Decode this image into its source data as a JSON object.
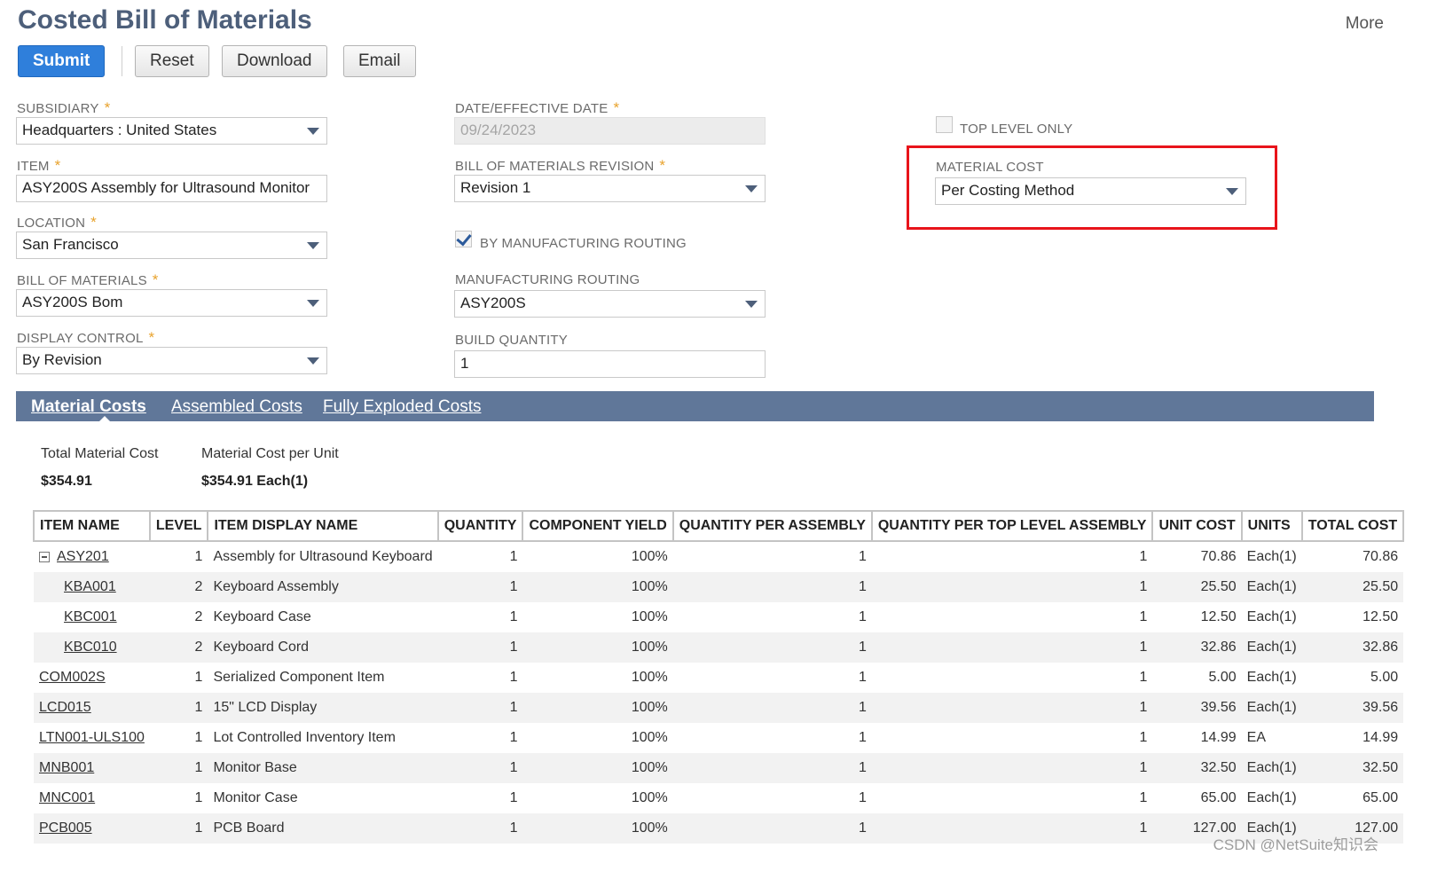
{
  "page": {
    "title": "Costed Bill of Materials",
    "more": "More"
  },
  "buttons": {
    "submit": "Submit",
    "reset": "Reset",
    "download": "Download",
    "email": "Email"
  },
  "fields": {
    "subsidiary": {
      "label": "SUBSIDIARY",
      "value": "Headquarters : United States",
      "required": "*"
    },
    "item": {
      "label": "ITEM",
      "value": "ASY200S Assembly for Ultrasound Monitor",
      "required": "*"
    },
    "location": {
      "label": "LOCATION",
      "value": "San Francisco",
      "required": "*"
    },
    "bom": {
      "label": "BILL OF MATERIALS",
      "value": "ASY200S Bom",
      "required": "*"
    },
    "display_control": {
      "label": "DISPLAY CONTROL",
      "value": "By Revision",
      "required": "*"
    },
    "date": {
      "label": "DATE/EFFECTIVE DATE",
      "value": "09/24/2023",
      "required": "*"
    },
    "bom_revision": {
      "label": "BILL OF MATERIALS REVISION",
      "value": "Revision 1",
      "required": "*"
    },
    "by_routing": {
      "label": "BY MANUFACTURING ROUTING",
      "checked": true
    },
    "routing": {
      "label": "MANUFACTURING ROUTING",
      "value": "ASY200S"
    },
    "build_qty": {
      "label": "BUILD QUANTITY",
      "value": "1"
    },
    "top_level": {
      "label": "TOP LEVEL ONLY",
      "checked": false
    },
    "material_cost": {
      "label": "MATERIAL COST",
      "value": "Per Costing Method"
    }
  },
  "highlight_color": "#e8141b",
  "tabs": [
    {
      "label": "Material Costs",
      "active": true
    },
    {
      "label": "Assembled Costs",
      "active": false
    },
    {
      "label": "Fully Exploded Costs",
      "active": false
    }
  ],
  "summary": {
    "total_label": "Total Material Cost",
    "total_value": "$354.91",
    "per_unit_label": "Material Cost per Unit",
    "per_unit_value": "$354.91 Each(1)"
  },
  "table": {
    "columns": [
      "ITEM NAME",
      "LEVEL",
      "ITEM DISPLAY NAME",
      "QUANTITY",
      "COMPONENT YIELD",
      "QUANTITY PER ASSEMBLY",
      "QUANTITY PER TOP LEVEL ASSEMBLY",
      "UNIT COST",
      "UNITS",
      "TOTAL COST"
    ],
    "rows": [
      {
        "name": "ASY201",
        "level": "1",
        "display": "Assembly for Ultrasound Keyboard",
        "qty": "1",
        "yield": "100%",
        "qpa": "1",
        "qptla": "1",
        "unit_cost": "70.86",
        "units": "Each(1)",
        "total": "70.86",
        "collapsible": true
      },
      {
        "name": "KBA001",
        "level": "2",
        "display": "Keyboard Assembly",
        "qty": "1",
        "yield": "100%",
        "qpa": "1",
        "qptla": "1",
        "unit_cost": "25.50",
        "units": "Each(1)",
        "total": "25.50",
        "child": true
      },
      {
        "name": "KBC001",
        "level": "2",
        "display": "Keyboard Case",
        "qty": "1",
        "yield": "100%",
        "qpa": "1",
        "qptla": "1",
        "unit_cost": "12.50",
        "units": "Each(1)",
        "total": "12.50",
        "child": true
      },
      {
        "name": "KBC010",
        "level": "2",
        "display": "Keyboard Cord",
        "qty": "1",
        "yield": "100%",
        "qpa": "1",
        "qptla": "1",
        "unit_cost": "32.86",
        "units": "Each(1)",
        "total": "32.86",
        "child": true
      },
      {
        "name": "COM002S",
        "level": "1",
        "display": "Serialized Component Item",
        "qty": "1",
        "yield": "100%",
        "qpa": "1",
        "qptla": "1",
        "unit_cost": "5.00",
        "units": "Each(1)",
        "total": "5.00"
      },
      {
        "name": "LCD015",
        "level": "1",
        "display": "15\" LCD Display",
        "qty": "1",
        "yield": "100%",
        "qpa": "1",
        "qptla": "1",
        "unit_cost": "39.56",
        "units": "Each(1)",
        "total": "39.56"
      },
      {
        "name": "LTN001-ULS100",
        "level": "1",
        "display": "Lot Controlled Inventory Item",
        "qty": "1",
        "yield": "100%",
        "qpa": "1",
        "qptla": "1",
        "unit_cost": "14.99",
        "units": "EA",
        "total": "14.99"
      },
      {
        "name": "MNB001",
        "level": "1",
        "display": "Monitor Base",
        "qty": "1",
        "yield": "100%",
        "qpa": "1",
        "qptla": "1",
        "unit_cost": "32.50",
        "units": "Each(1)",
        "total": "32.50"
      },
      {
        "name": "MNC001",
        "level": "1",
        "display": "Monitor Case",
        "qty": "1",
        "yield": "100%",
        "qpa": "1",
        "qptla": "1",
        "unit_cost": "65.00",
        "units": "Each(1)",
        "total": "65.00"
      },
      {
        "name": "PCB005",
        "level": "1",
        "display": "PCB Board",
        "qty": "1",
        "yield": "100%",
        "qpa": "1",
        "qptla": "1",
        "unit_cost": "127.00",
        "units": "Each(1)",
        "total": "127.00"
      }
    ]
  },
  "watermark": "CSDN @NetSuite知识会"
}
